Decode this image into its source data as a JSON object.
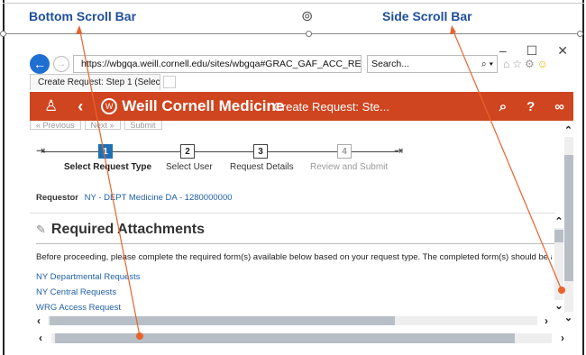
{
  "annotations": {
    "left_label": "Bottom Scroll Bar",
    "right_label": "Side Scroll Bar",
    "center_icon": "mouse-pointer-icon",
    "line_color": "#e8632b"
  },
  "browser": {
    "window_controls": [
      "–",
      "☐",
      "✕"
    ],
    "url": "https://wbgqa.weill.cornell.edu/sites/wbgqa#GRAC_GAF_ACC_REQ",
    "search_placeholder": "Search...",
    "tab_title": "Create Request: Step 1 (Selec..."
  },
  "app": {
    "brand": "Weill Cornell Medicine",
    "page_title": "Create Request: Ste...",
    "header_color": "#cf4520",
    "step_buttons": [
      "« Previous",
      "Next »",
      "Submit"
    ]
  },
  "stepper": {
    "steps": [
      {
        "number": "1",
        "label": "Select Request Type",
        "state": "active"
      },
      {
        "number": "2",
        "label": "Select User",
        "state": "normal"
      },
      {
        "number": "3",
        "label": "Request Details",
        "state": "normal"
      },
      {
        "number": "4",
        "label": "Review and Submit",
        "state": "disabled"
      }
    ]
  },
  "requestor": {
    "label": "Requestor",
    "value": "NY - DEPT Medicine DA - 1280000000"
  },
  "attachments": {
    "heading": "Required Attachments",
    "instructions": "Before proceeding, please complete the required form(s) available below based on your request type.  The completed form(s) should be atta",
    "links": [
      "NY Departmental Requests",
      "NY Central Requests",
      "WRG Access Request"
    ]
  }
}
